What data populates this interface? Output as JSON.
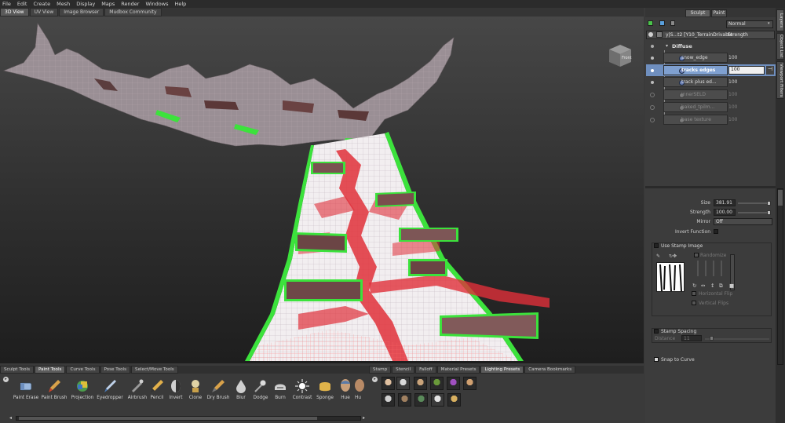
{
  "menu": [
    "File",
    "Edit",
    "Create",
    "Mesh",
    "Display",
    "Maps",
    "Render",
    "Windows",
    "Help"
  ],
  "view_tabs": [
    "3D View",
    "UV View",
    "Image Browser",
    "Mudbox Community"
  ],
  "viewcube_label": "Front",
  "mode_tabs": [
    "Sculpt",
    "Paint"
  ],
  "blend_mode": "Normal",
  "layer_header": {
    "name": "y|S...t2 [Y10_TerrainDrivable",
    "column": "Strength"
  },
  "group_name": "Diffuse",
  "layers": [
    {
      "name": "snow_edge",
      "value": "100",
      "enabled": true
    },
    {
      "name": "tracks edges",
      "value": "100",
      "enabled": true,
      "selected": true
    },
    {
      "name": "track plus ed...",
      "value": "100",
      "enabled": true
    },
    {
      "name": "innerSELD",
      "value": "100",
      "enabled": false
    },
    {
      "name": "baked_tpilm...",
      "value": "100",
      "enabled": false
    },
    {
      "name": "base texture",
      "value": "100",
      "enabled": false
    }
  ],
  "side_tabs": [
    "Layers",
    "Object List",
    "Viewport Filters"
  ],
  "properties": {
    "size_label": "Size",
    "size_value": "381.91",
    "strength_label": "Strength",
    "strength_value": "100.00",
    "mirror_label": "Mirror",
    "mirror_value": "Off",
    "invert_label": "Invert Function",
    "stamp_label": "Use Stamp Image",
    "randomize_label": "Randomize",
    "hflip_label": "Horizontal Flip",
    "vflip_label": "Vertical Flips",
    "spacing_label": "Stamp Spacing",
    "distance_label": "Distance",
    "distance_value": "11",
    "snap_label": "Snap to Curve"
  },
  "bottom_tabs_left": [
    "Sculpt Tools",
    "Paint Tools",
    "Curve Tools",
    "Pose Tools",
    "Select/Move Tools"
  ],
  "bottom_tabs_left_active": 1,
  "bottom_tabs_right": [
    "Stamp",
    "Stencil",
    "Falloff",
    "Material Presets",
    "Lighting Presets",
    "Camera Bookmarks"
  ],
  "bottom_tabs_right_active": 4,
  "tools": [
    {
      "label": "Paint Erase",
      "icon": "eraser-icon"
    },
    {
      "label": "Paint Brush",
      "icon": "paint-brush-icon"
    },
    {
      "label": "Projection",
      "icon": "projection-icon"
    },
    {
      "label": "Eyedropper",
      "icon": "eyedropper-icon"
    },
    {
      "label": "Airbrush",
      "icon": "airbrush-icon"
    },
    {
      "label": "Pencil",
      "icon": "pencil-icon"
    },
    {
      "label": "Invert",
      "icon": "invert-icon"
    },
    {
      "label": "Clone",
      "icon": "clone-icon"
    },
    {
      "label": "Dry Brush",
      "icon": "dry-brush-icon"
    },
    {
      "label": "Blur",
      "icon": "blur-icon"
    },
    {
      "label": "Dodge",
      "icon": "dodge-icon"
    },
    {
      "label": "Burn",
      "icon": "burn-icon"
    },
    {
      "label": "Contrast",
      "icon": "contrast-icon"
    },
    {
      "label": "Sponge",
      "icon": "sponge-icon"
    },
    {
      "label": "Hue",
      "icon": "hue-icon"
    },
    {
      "label": "Hu",
      "icon": "hue-shift-icon"
    }
  ],
  "colors": {
    "accent": "#6b8fc4",
    "mesh_red": "#e0303a",
    "mesh_green": "#3ce23c",
    "selected_row": "#6f8fbf"
  }
}
